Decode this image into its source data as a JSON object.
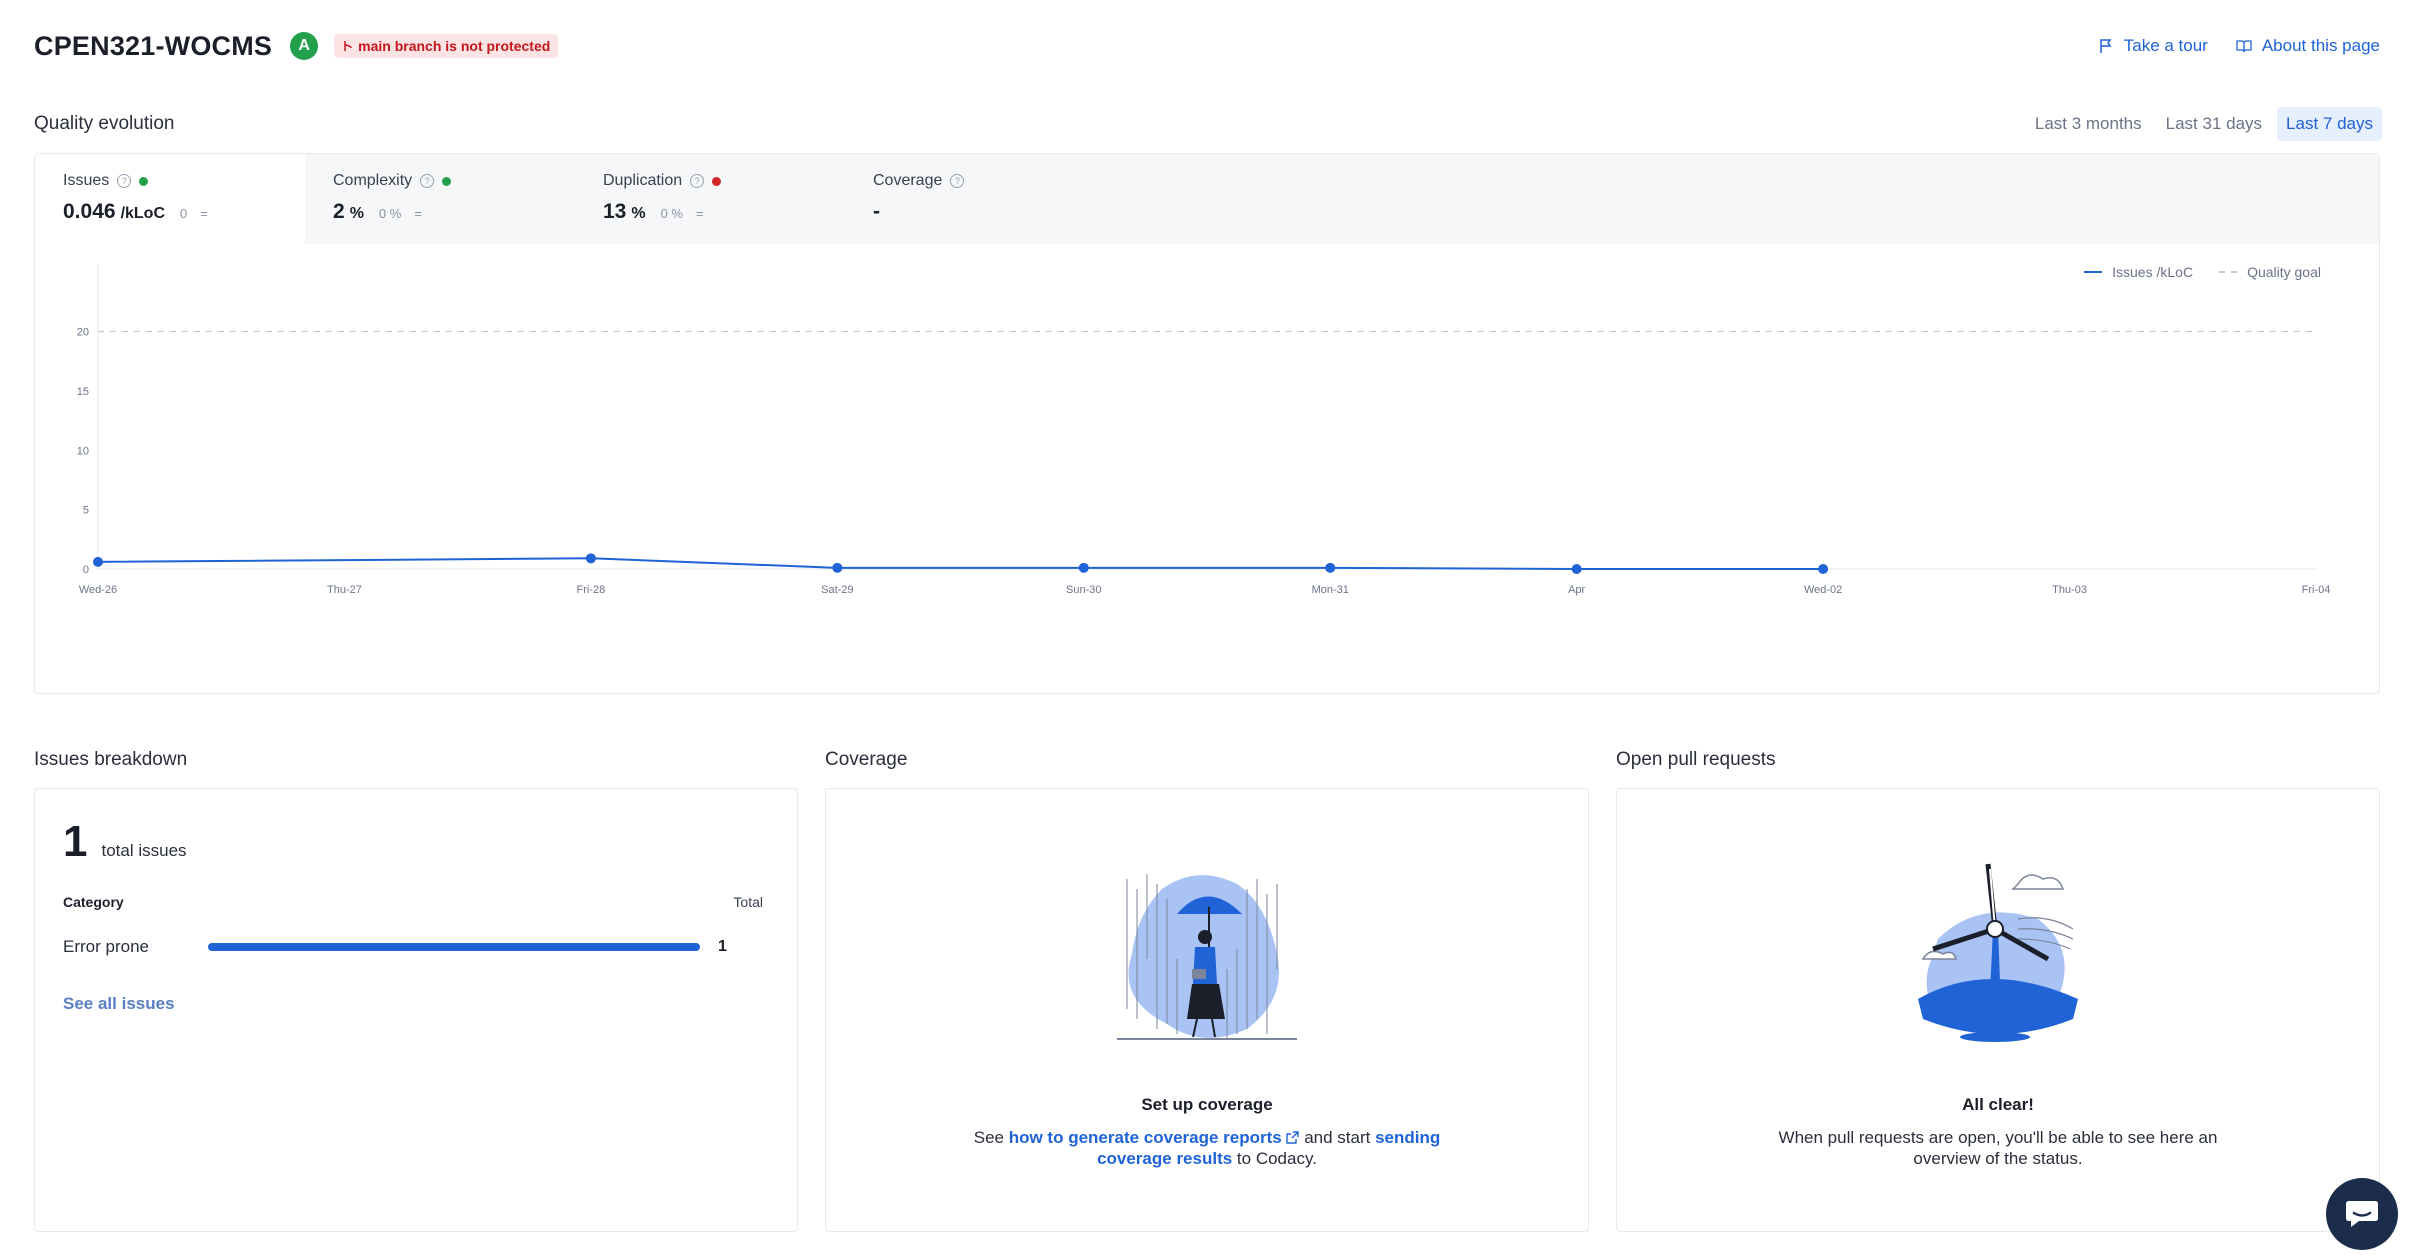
{
  "header": {
    "title": "CPEN321-WOCMS",
    "grade": "A",
    "branch_warning": "main branch is not protected",
    "take_tour": "Take a tour",
    "about": "About this page"
  },
  "quality_evolution": {
    "heading": "Quality evolution",
    "ranges": [
      "Last 3 months",
      "Last 31 days",
      "Last 7 days"
    ],
    "active_range": "Last 7 days",
    "metrics": [
      {
        "label": "Issues",
        "value": "0.046",
        "unit": "/kLoC",
        "delta": "0",
        "trend": "=",
        "status": "green"
      },
      {
        "label": "Complexity",
        "value": "2",
        "unit": "%",
        "delta": "0 %",
        "trend": "=",
        "status": "green"
      },
      {
        "label": "Duplication",
        "value": "13",
        "unit": "%",
        "delta": "0 %",
        "trend": "=",
        "status": "red"
      },
      {
        "label": "Coverage",
        "value": "-",
        "unit": "",
        "delta": "",
        "trend": "",
        "status": ""
      }
    ],
    "legend": {
      "series": "Issues /kLoC",
      "goal": "Quality goal"
    }
  },
  "chart_data": {
    "type": "line",
    "x": [
      "Wed-26",
      "Thu-27",
      "Fri-28",
      "Sat-29",
      "Sun-30",
      "Mon-31",
      "Apr",
      "Wed-02",
      "Thu-03",
      "Fri-04"
    ],
    "series": [
      {
        "name": "Issues /kLoC",
        "values": [
          0.6,
          null,
          0.9,
          0.1,
          0.1,
          0.1,
          0.0,
          0.0,
          null,
          null
        ],
        "color": "#1f63d6"
      }
    ],
    "goal": 20,
    "goal_name": "Quality goal",
    "yticks": [
      0,
      5,
      10,
      15,
      20
    ],
    "ylim": [
      0,
      24
    ],
    "grid": false
  },
  "issues_breakdown": {
    "heading": "Issues breakdown",
    "total": "1",
    "total_label": "total issues",
    "col_category": "Category",
    "col_total": "Total",
    "rows": [
      {
        "category": "Error prone",
        "count": "1",
        "fraction": 1.0
      }
    ],
    "see_all": "See all issues"
  },
  "coverage": {
    "heading": "Coverage",
    "empty_title": "Set up coverage",
    "text_1": "See ",
    "link_1": "how to generate coverage reports",
    "text_2": " and start ",
    "link_2": "sending coverage results",
    "text_3": " to Codacy."
  },
  "pull_requests": {
    "heading": "Open pull requests",
    "empty_title": "All clear!",
    "text": "When pull requests are open, you'll be able to see here an overview of the status."
  },
  "colors": {
    "accent": "#1f63d6",
    "good": "#22a04b",
    "bad": "#d4252b",
    "chat": "#1b2d4a"
  }
}
